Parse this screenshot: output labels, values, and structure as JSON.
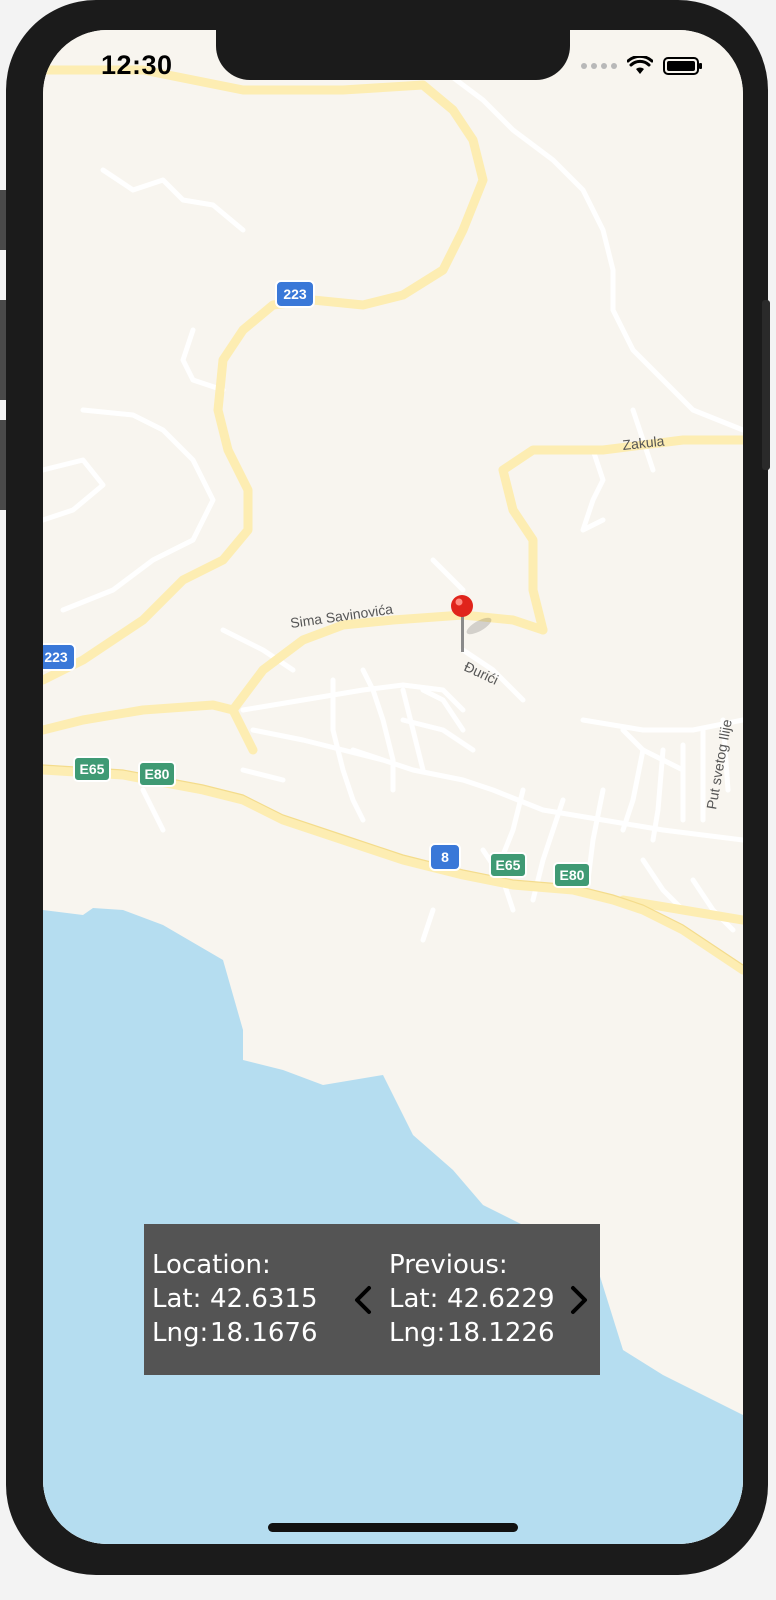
{
  "status_bar": {
    "time": "12:30",
    "icons": [
      "signal-dots-icon",
      "wifi-icon",
      "battery-icon"
    ]
  },
  "map": {
    "road_labels": [
      "Sima Savinovića",
      "Zakula",
      "Đurići",
      "Put svetog Ilije"
    ],
    "shields": {
      "route_223_top": "223",
      "route_223_left": "223",
      "route_8": "8",
      "e65_left": "E65",
      "e80_left": "E80",
      "e65_right": "E65",
      "e80_right": "E80"
    },
    "colors": {
      "land": "#f8f5ef",
      "water": "#b5ddf0",
      "major_road": "#fdedb2",
      "minor_road": "#ffffff",
      "shield_blue": "#3a78d8",
      "shield_green": "#3f9a74",
      "pin": "#e0241b"
    }
  },
  "location_panel": {
    "current": {
      "title": "Location:",
      "lat_label": "Lat:",
      "lat": "42.6315",
      "lng_label": "Lng:",
      "lng": "18.1676"
    },
    "previous": {
      "title": "Previous:",
      "lat_label": "Lat:",
      "lat": "42.6229",
      "lng_label": "Lng:",
      "lng": "18.1226"
    },
    "prev_icon": "chevron-left-icon",
    "next_icon": "chevron-right-icon"
  }
}
